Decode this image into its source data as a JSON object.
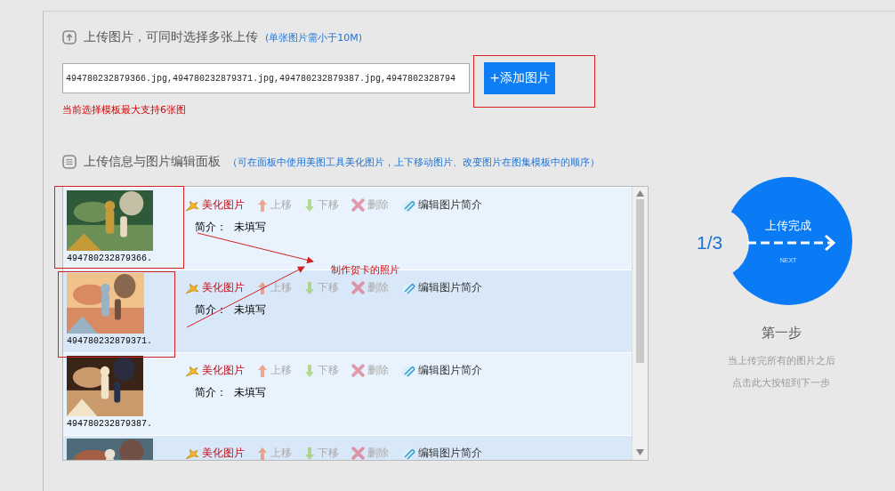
{
  "upload": {
    "title": "上传图片，可同时选择多张上传",
    "hint": "(单张图片需小于10M)",
    "files_value": "494780232879366.jpg,494780232879371.jpg,494780232879387.jpg,4947802328794",
    "add_button": "+添加图片",
    "limit_note": "当前选择模板最大支持6张图"
  },
  "editor": {
    "title": "上传信息与图片编辑面板",
    "hint": "（可在面板中使用美图工具美化图片，上下移动图片、改变图片在图集模板中的顺序）",
    "rows": [
      {
        "filename": "494780232879366.",
        "intro_label": "简介：",
        "intro_value": "未填写",
        "actions": [
          {
            "kind": "beautify",
            "label": "美化图片",
            "disabled": false
          },
          {
            "kind": "up",
            "label": "上移",
            "disabled": true
          },
          {
            "kind": "down",
            "label": "下移",
            "disabled": true
          },
          {
            "kind": "delete",
            "label": "删除",
            "disabled": true
          },
          {
            "kind": "edit",
            "label": "编辑图片简介",
            "disabled": false
          }
        ]
      },
      {
        "filename": "494780232879371.",
        "intro_label": "简介：",
        "intro_value": "未填写",
        "actions": [
          {
            "kind": "beautify",
            "label": "美化图片",
            "disabled": false
          },
          {
            "kind": "up",
            "label": "上移",
            "disabled": true
          },
          {
            "kind": "down",
            "label": "下移",
            "disabled": true
          },
          {
            "kind": "delete",
            "label": "删除",
            "disabled": true
          },
          {
            "kind": "edit",
            "label": "编辑图片简介",
            "disabled": false
          }
        ]
      },
      {
        "filename": "494780232879387.",
        "intro_label": "简介：",
        "intro_value": "未填写",
        "actions": [
          {
            "kind": "beautify",
            "label": "美化图片",
            "disabled": false
          },
          {
            "kind": "up",
            "label": "上移",
            "disabled": true
          },
          {
            "kind": "down",
            "label": "下移",
            "disabled": true
          },
          {
            "kind": "delete",
            "label": "删除",
            "disabled": true
          },
          {
            "kind": "edit",
            "label": "编辑图片简介",
            "disabled": false
          }
        ]
      },
      {
        "actions": [
          {
            "kind": "beautify",
            "label": "美化图片",
            "disabled": false
          },
          {
            "kind": "up",
            "label": "上移",
            "disabled": true
          },
          {
            "kind": "down",
            "label": "下移",
            "disabled": true
          },
          {
            "kind": "delete",
            "label": "删除",
            "disabled": true
          },
          {
            "kind": "edit",
            "label": "编辑图片简介",
            "disabled": false
          }
        ]
      }
    ]
  },
  "annotation": {
    "text": "制作贺卡的照片"
  },
  "step": {
    "counter": "1/3",
    "button_label": "上传完成",
    "button_sub": "NEXT",
    "title": "第一步",
    "desc_line_1": "当上传完所有的图片之后",
    "desc_line_2": "点击此大按钮到下一步"
  }
}
